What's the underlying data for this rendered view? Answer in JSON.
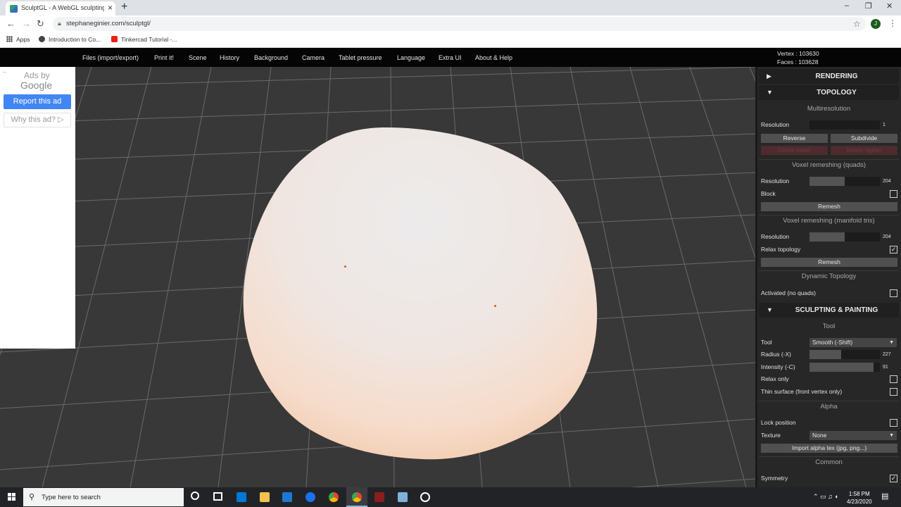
{
  "browser": {
    "tab_title": "SculptGL - A WebGL sculpting ap",
    "url": "stephaneginier.com/sculptgl/",
    "profile_initial": "J",
    "bookmarks": [
      "Apps",
      "Introduction to Co...",
      "Tinkercad Tutorial -..."
    ]
  },
  "menu": {
    "items": [
      "Files (import/export)",
      "Print it!",
      "Scene",
      "History",
      "Background",
      "Camera",
      "Tablet pressure",
      "Language",
      "Extra UI",
      "About & Help"
    ]
  },
  "stats": {
    "vertex": "Vertex : 103630",
    "faces": "Faces : 103628"
  },
  "ad": {
    "ads_by": "Ads by",
    "google": "Google",
    "report": "Report this ad",
    "why": "Why this ad? ▷"
  },
  "panel": {
    "rendering": "RENDERING",
    "topology": "TOPOLOGY",
    "multires": {
      "title": "Multiresolution",
      "resolution_label": "Resolution",
      "resolution_value": "1",
      "resolution_fill": 0.0,
      "reverse": "Reverse",
      "subdivide": "Subdivide",
      "delete_lower": "Delete lower",
      "delete_higher": "Delete higher"
    },
    "voxel_quads": {
      "title": "Voxel remeshing (quads)",
      "resolution_label": "Resolution",
      "resolution_value": "204",
      "resolution_fill": 0.5,
      "block_label": "Block",
      "block_checked": false,
      "remesh": "Remesh"
    },
    "voxel_tris": {
      "title": "Voxel remeshing (manifold tris)",
      "resolution_label": "Resolution",
      "resolution_value": "204",
      "resolution_fill": 0.5,
      "relax_label": "Relax topology",
      "relax_checked": true,
      "remesh": "Remesh"
    },
    "dyntopo": {
      "title": "Dynamic Topology",
      "activated_label": "Activated (no quads)",
      "activated_checked": false
    },
    "sculpting": "SCULPTING & PAINTING",
    "tool": {
      "title": "Tool",
      "tool_label": "Tool",
      "tool_value": "Smooth (-Shift)",
      "radius_label": "Radius (-X)",
      "radius_value": "227",
      "radius_fill": 0.45,
      "intensity_label": "Intensity (-C)",
      "intensity_value": "91",
      "intensity_fill": 0.91,
      "relax_only_label": "Relax only",
      "relax_only_checked": false,
      "thin_surface_label": "Thin surface (front vertex only)",
      "thin_surface_checked": false
    },
    "alpha": {
      "title": "Alpha",
      "lock_label": "Lock position",
      "lock_checked": false,
      "texture_label": "Texture",
      "texture_value": "None",
      "import": "Import alpha tex (jpg, png...)"
    },
    "common": {
      "title": "Common",
      "symmetry_label": "Symmetry",
      "symmetry_checked": true
    }
  },
  "taskbar": {
    "search_placeholder": "Type here to search",
    "time": "1:58 PM",
    "date": "4/23/2020"
  }
}
